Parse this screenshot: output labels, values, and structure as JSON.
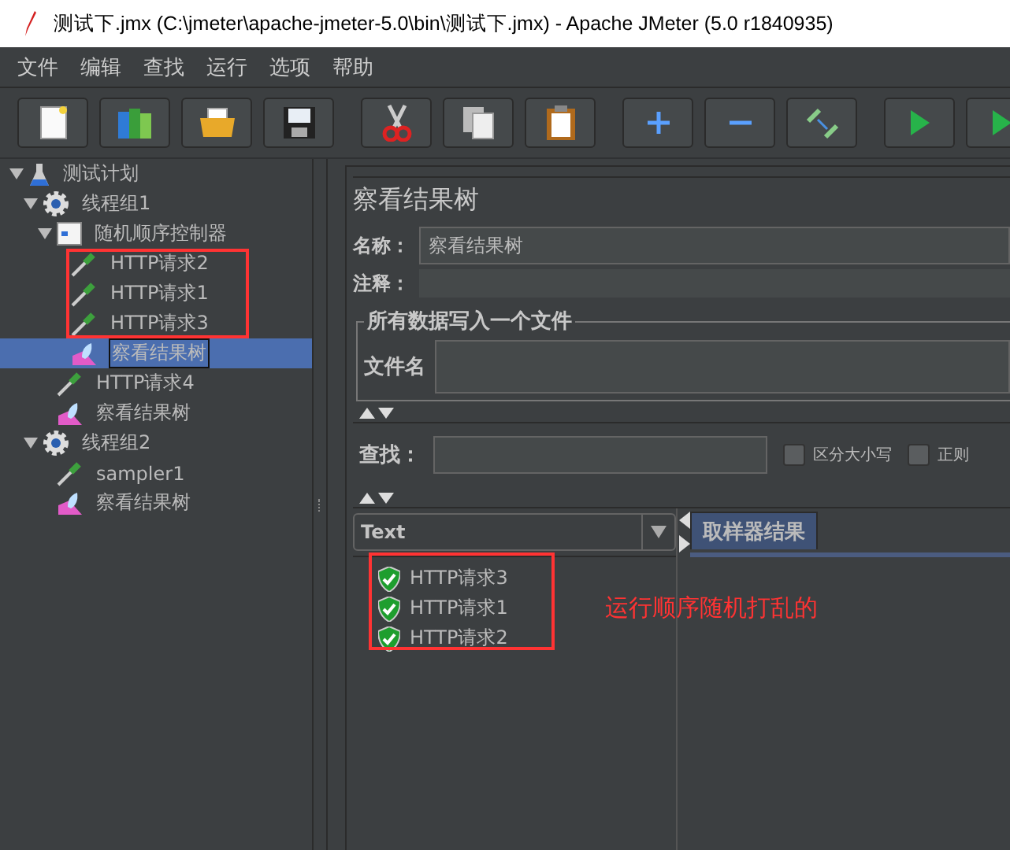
{
  "window": {
    "title": "测试下.jmx (C:\\jmeter\\apache-jmeter-5.0\\bin\\测试下.jmx) - Apache JMeter (5.0 r1840935)"
  },
  "menu": [
    "文件",
    "编辑",
    "查找",
    "运行",
    "选项",
    "帮助"
  ],
  "tree": [
    {
      "label": "测试计划",
      "kind": "plan",
      "expanded": true,
      "selected": false,
      "children": [
        {
          "label": "线程组1",
          "kind": "threadgroup",
          "expanded": true,
          "selected": false,
          "children": [
            {
              "label": "随机顺序控制器",
              "kind": "controller",
              "expanded": true,
              "selected": false,
              "children": [
                {
                  "label": "HTTP请求2",
                  "kind": "sampler",
                  "selected": false
                },
                {
                  "label": "HTTP请求1",
                  "kind": "sampler",
                  "selected": false
                },
                {
                  "label": "HTTP请求3",
                  "kind": "sampler",
                  "selected": false
                },
                {
                  "label": "察看结果树",
                  "kind": "listener",
                  "selected": true
                }
              ]
            },
            {
              "label": "HTTP请求4",
              "kind": "sampler",
              "selected": false
            },
            {
              "label": "察看结果树",
              "kind": "listener",
              "selected": false
            }
          ]
        },
        {
          "label": "线程组2",
          "kind": "threadgroup",
          "expanded": true,
          "selected": false,
          "children": [
            {
              "label": "sampler1",
              "kind": "sampler",
              "selected": false
            },
            {
              "label": "察看结果树",
              "kind": "listener",
              "selected": false
            }
          ]
        }
      ]
    }
  ],
  "panel": {
    "title": "察看结果树",
    "name_label": "名称：",
    "name_value": "察看结果树",
    "comment_label": "注释：",
    "file_group": "所有数据写入一个文件",
    "file_label": "文件名",
    "search_label": "查找：",
    "checkboxes": [
      {
        "label": "区分大小写",
        "checked": false
      },
      {
        "label": "正则",
        "checked": false
      }
    ],
    "renderer": "Text",
    "results": [
      {
        "label": "HTTP请求3",
        "success": true
      },
      {
        "label": "HTTP请求1",
        "success": true
      },
      {
        "label": "HTTP请求2",
        "success": true
      }
    ],
    "tabs": [
      {
        "label": "取样器结果",
        "selected": true
      }
    ]
  },
  "annotation": {
    "text": "运行顺序随机打乱的"
  }
}
